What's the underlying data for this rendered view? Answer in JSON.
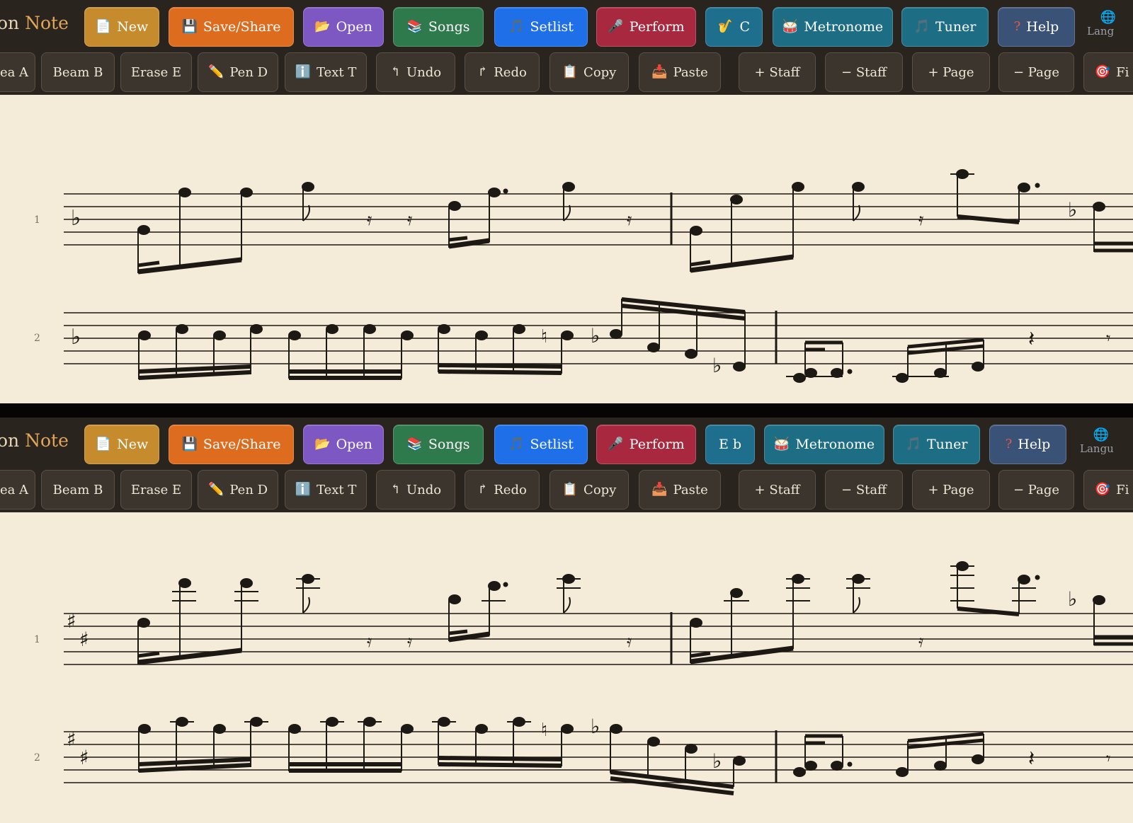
{
  "app": {
    "brand_prefix": "on",
    "brand_accent": "Note"
  },
  "colors": {
    "paper": "#f4ebd9",
    "toolbar": "#2a241f",
    "ink": "#1c1814",
    "new": "#c58b2c",
    "save": "#de6c1f",
    "open": "#7d57c2",
    "songs": "#2f7a4c",
    "setlist": "#1f6fe8",
    "perform": "#a8283f",
    "key": "#1e6e8e",
    "metronome": "#1d6e84",
    "tuner": "#1d6e84",
    "help": "#3b5277"
  },
  "toolbar_main": {
    "new": "New",
    "save": "Save/Share",
    "open": "Open",
    "songs": "Songs",
    "setlist": "Setlist",
    "perform": "Perform",
    "metronome": "Metronome",
    "tuner": "Tuner",
    "help": "Help",
    "language": "Lang",
    "language_bottom": "Langu"
  },
  "toolbar_tools": {
    "area": "ea A",
    "beam": "Beam B",
    "erase": "Erase E",
    "pen": "Pen D",
    "text": "Text T",
    "undo": "Undo",
    "redo": "Redo",
    "copy": "Copy",
    "paste": "Paste",
    "add_staff": "+ Staff",
    "remove_staff": "− Staff",
    "add_page": "+ Page",
    "remove_page": "− Page",
    "focus": "Fi"
  },
  "icons": {
    "new": "page-icon",
    "save": "floppy-disk-icon",
    "open": "folder-icon",
    "songs": "book-stack-icon",
    "setlist": "music-note-icon",
    "perform": "microphone-icon",
    "key": "saxophone-icon",
    "metronome": "drum-icon",
    "tuner": "music-note-icon",
    "help": "question-mark-icon",
    "language": "globe-icon",
    "pen": "pencil-icon",
    "text": "info-icon",
    "undo": "undo-arrow-icon",
    "redo": "redo-arrow-icon",
    "copy": "clipboard-icon",
    "paste": "inbox-tray-icon",
    "focus": "target-icon"
  },
  "views": [
    {
      "transpose_label": "C",
      "key_signature": "one flat",
      "staves": [
        {
          "number": "1"
        },
        {
          "number": "2"
        }
      ]
    },
    {
      "transpose_label": "E b",
      "key_signature": "two sharps",
      "staves": [
        {
          "number": "1"
        },
        {
          "number": "2"
        }
      ]
    }
  ]
}
